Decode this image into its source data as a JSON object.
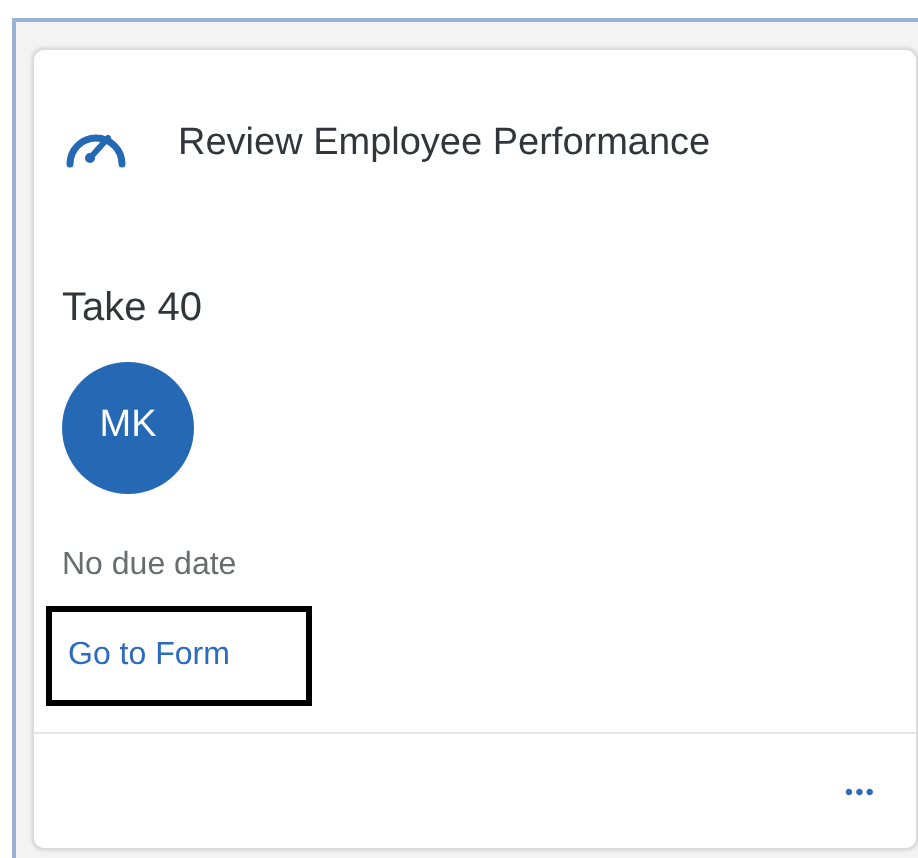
{
  "card": {
    "title": "Review Employee Performance",
    "subject": "Take 40",
    "avatar": {
      "initials": "MK"
    },
    "due": "No due date",
    "link": {
      "label": "Go to Form",
      "highlighted": true
    },
    "footer": {
      "more": "•••"
    }
  }
}
